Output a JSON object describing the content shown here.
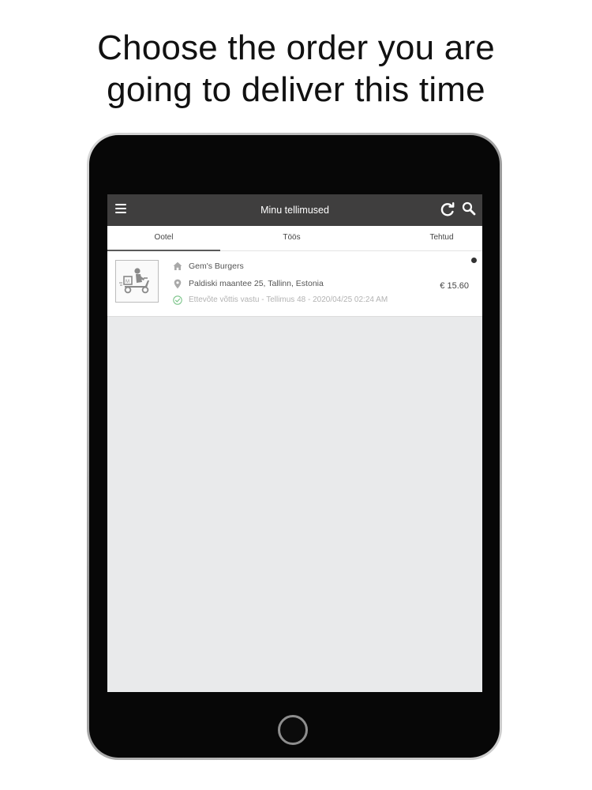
{
  "headline": {
    "line1": "Choose the order you are",
    "line2": "going to deliver this time"
  },
  "appbar": {
    "title": "Minu tellimused",
    "menu_icon": "menu-icon",
    "refresh_icon": "refresh-icon",
    "search_icon": "search-icon"
  },
  "tabs": [
    {
      "label": "Ootel",
      "active": true
    },
    {
      "label": "Töös",
      "active": false
    },
    {
      "label": "Tehtud",
      "active": false
    }
  ],
  "orders": [
    {
      "restaurant": "Gem's Burgers",
      "address": "Paldiski maantee 25, Tallinn, Estonia",
      "status": "Ettevõte võttis vastu - Tellimus 48 - 2020/04/25 02:24 AM",
      "price": "€ 15.60",
      "unread": true,
      "thumbnail_icon": "delivery-scooter-icon"
    }
  ],
  "colors": {
    "appbar_bg": "#3f3e3e",
    "screen_bg": "#e9eaeb",
    "tablet_body": "#070707",
    "status_ok": "#7cc58a"
  }
}
